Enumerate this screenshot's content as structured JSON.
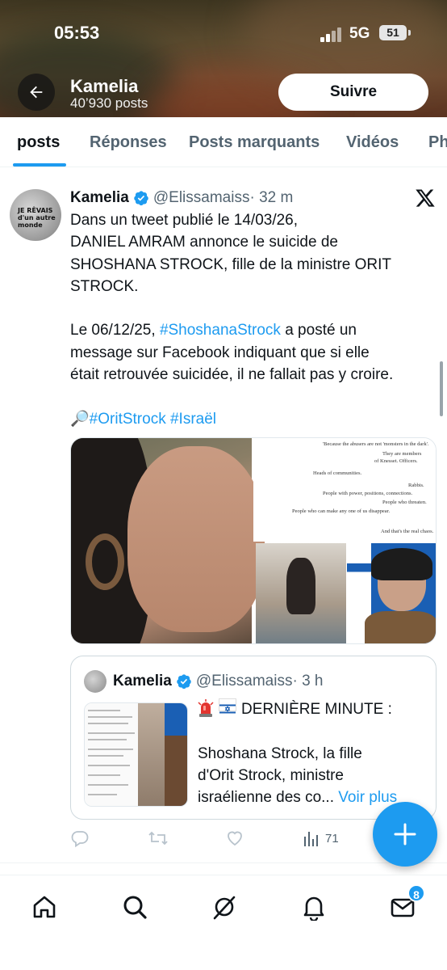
{
  "status_bar": {
    "time": "05:53",
    "network": "5G",
    "battery": "51"
  },
  "header": {
    "profile_name": "Kamelia",
    "post_count": "40’930 posts",
    "follow_label": "Suivre"
  },
  "tabs": [
    {
      "label": "posts",
      "active": true
    },
    {
      "label": "Réponses",
      "active": false
    },
    {
      "label": "Posts marquants",
      "active": false
    },
    {
      "label": "Vidéos",
      "active": false
    },
    {
      "label": "Ph",
      "active": false
    }
  ],
  "tweet": {
    "name": "Kamelia",
    "handle": "@Elissamaiss",
    "time": "· 32 m",
    "avatar_text": "JE RÊVAIS d'un autre monde",
    "lines": [
      "Dans un tweet publié le 14/03/26,",
      "DANIEL AMRAM annonce le suicide de",
      "SHOSHANA STROCK, fille de la ministre ORIT",
      "STROCK."
    ],
    "p2_prefix": "Le 06/12/25, ",
    "p2_hashtag": "#ShoshanaStrock",
    "p2_rest_1": " a posté un",
    "p2_line2": "message sur Facebook indiquant que si elle",
    "p2_line3": "était retrouvée suicidée, il ne fallait pas y croire.",
    "p3_emoji": "🔎",
    "p3_hashtags": "#OritStrock #Israël",
    "media_doc": [
      "'Because the abusers are not 'monsters in the dark'.",
      "They are members",
      "of Knesset. Officers.",
      "Heads of communities.",
      "Rabbis.",
      "People with power, positions, connections.",
      "People who threaten.",
      "People who can make any one of us disappear.",
      "And that's the real chaos."
    ]
  },
  "quoted_tweet": {
    "name": "Kamelia",
    "handle": "@Elissamaiss",
    "time": "· 3 h",
    "line1": "DERNIÈRE MINUTE :",
    "line2": "Shoshana Strock, la fille",
    "line3": "d'Orit Strock, ministre",
    "line4": "israélienne des co...",
    "more": " Voir plus"
  },
  "actions": {
    "views": "71"
  },
  "bottom_nav": {
    "messages_badge": "8"
  },
  "colors": {
    "accent": "#1d9bf0",
    "text": "#0f1419",
    "muted": "#536471"
  }
}
